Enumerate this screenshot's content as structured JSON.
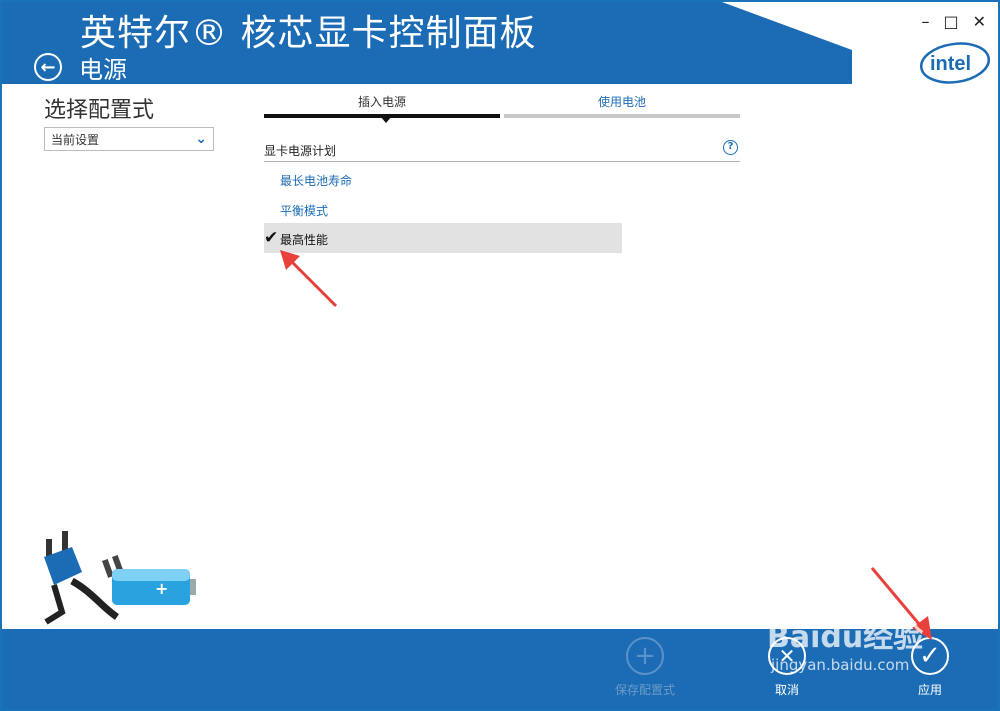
{
  "header": {
    "app_title": "英特尔® 核芯显卡控制面板",
    "section_title": "电源",
    "brand": "intel",
    "brand_color": "#1b6cb5"
  },
  "window_controls": {
    "minimize": "–",
    "maximize": "□",
    "close": "✕"
  },
  "sidebar": {
    "profile_label": "选择配置式",
    "profile_value": "当前设置"
  },
  "tabs": [
    {
      "label": "插入电源",
      "active": true
    },
    {
      "label": "使用电池",
      "active": false
    }
  ],
  "plan": {
    "heading": "显卡电源计划",
    "help": "?",
    "options": [
      {
        "label": "最长电池寿命",
        "selected": false
      },
      {
        "label": "平衡模式",
        "selected": false
      },
      {
        "label": "最高性能",
        "selected": true
      }
    ],
    "check_glyph": "✔"
  },
  "footer": {
    "save_label": "保存配置式",
    "cancel_label": "取消",
    "apply_label": "应用"
  },
  "watermark": {
    "brand": "Baidu经验",
    "url": "jingyan.baidu.com"
  }
}
